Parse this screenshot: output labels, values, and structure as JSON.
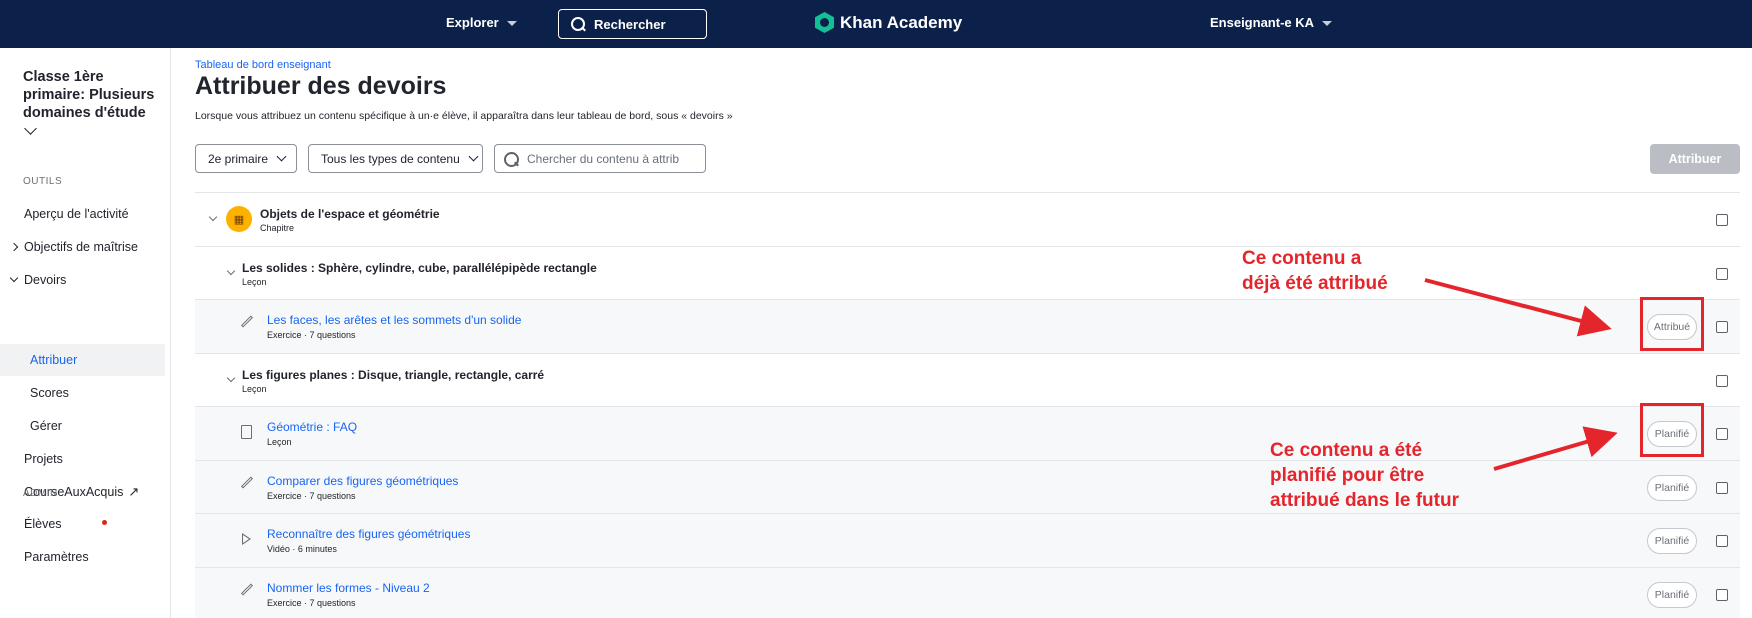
{
  "header": {
    "explorer_label": "Explorer",
    "search_label": "Rechercher",
    "logo_text": "Khan Academy",
    "user_label": "Enseignant-e KA"
  },
  "sidebar": {
    "class_title": "Classe 1ère primaire: Plusieurs domaines d'étude",
    "tools_section": "OUTILS",
    "admin_section": "ADMIN",
    "items": [
      {
        "label": "Aperçu de l'activité"
      },
      {
        "label": "Objectifs de maîtrise"
      },
      {
        "label": "Devoirs"
      },
      {
        "label": "Attribuer"
      },
      {
        "label": "Scores"
      },
      {
        "label": "Gérer"
      },
      {
        "label": "Projets"
      },
      {
        "label": "CourseAuxAcquis"
      },
      {
        "label": "Élèves"
      },
      {
        "label": "Paramètres"
      }
    ]
  },
  "main": {
    "breadcrumb": "Tableau de bord enseignant",
    "title": "Attribuer des devoirs",
    "description": "Lorsque vous attribuez un contenu spécifique à un·e élève, il apparaîtra dans leur tableau de bord, sous « devoirs »",
    "grade_filter": "2e primaire",
    "type_filter": "Tous les types de contenu",
    "search_placeholder": "Chercher du contenu à attrib",
    "assign_button": "Attribuer"
  },
  "rows": [
    {
      "title": "Objets de l'espace et géométrie",
      "subtitle": "Chapitre"
    },
    {
      "title": "Les solides : Sphère, cylindre, cube, parallélépipède rectangle",
      "subtitle": "Leçon"
    },
    {
      "title": "Les faces, les arêtes et les sommets d'un solide",
      "subtitle": "Exercice · 7 questions",
      "status": "Attribué"
    },
    {
      "title": "Les figures planes : Disque, triangle, rectangle, carré",
      "subtitle": "Leçon"
    },
    {
      "title": "Géométrie : FAQ",
      "subtitle": "Leçon",
      "status": "Planifié"
    },
    {
      "title": "Comparer des figures géométriques",
      "subtitle": "Exercice · 7 questions",
      "status": "Planifié"
    },
    {
      "title": "Reconnaître des figures géométriques",
      "subtitle": "Vidéo · 6 minutes",
      "status": "Planifié"
    },
    {
      "title": "Nommer les formes - Niveau 2",
      "subtitle": "Exercice · 7 questions",
      "status": "Planifié"
    }
  ],
  "annotations": {
    "assigned_line1": "Ce contenu a",
    "assigned_line2": "déjà été attribué",
    "planned_line1": "Ce contenu a été",
    "planned_line2": "planifié pour être",
    "planned_line3": "attribué dans le futur",
    "color": "#e4252c"
  },
  "colors": {
    "header_bg": "#0b2149",
    "link": "#1865f2",
    "logo_green": "#14bf96",
    "chapter_icon": "#ffb100"
  }
}
